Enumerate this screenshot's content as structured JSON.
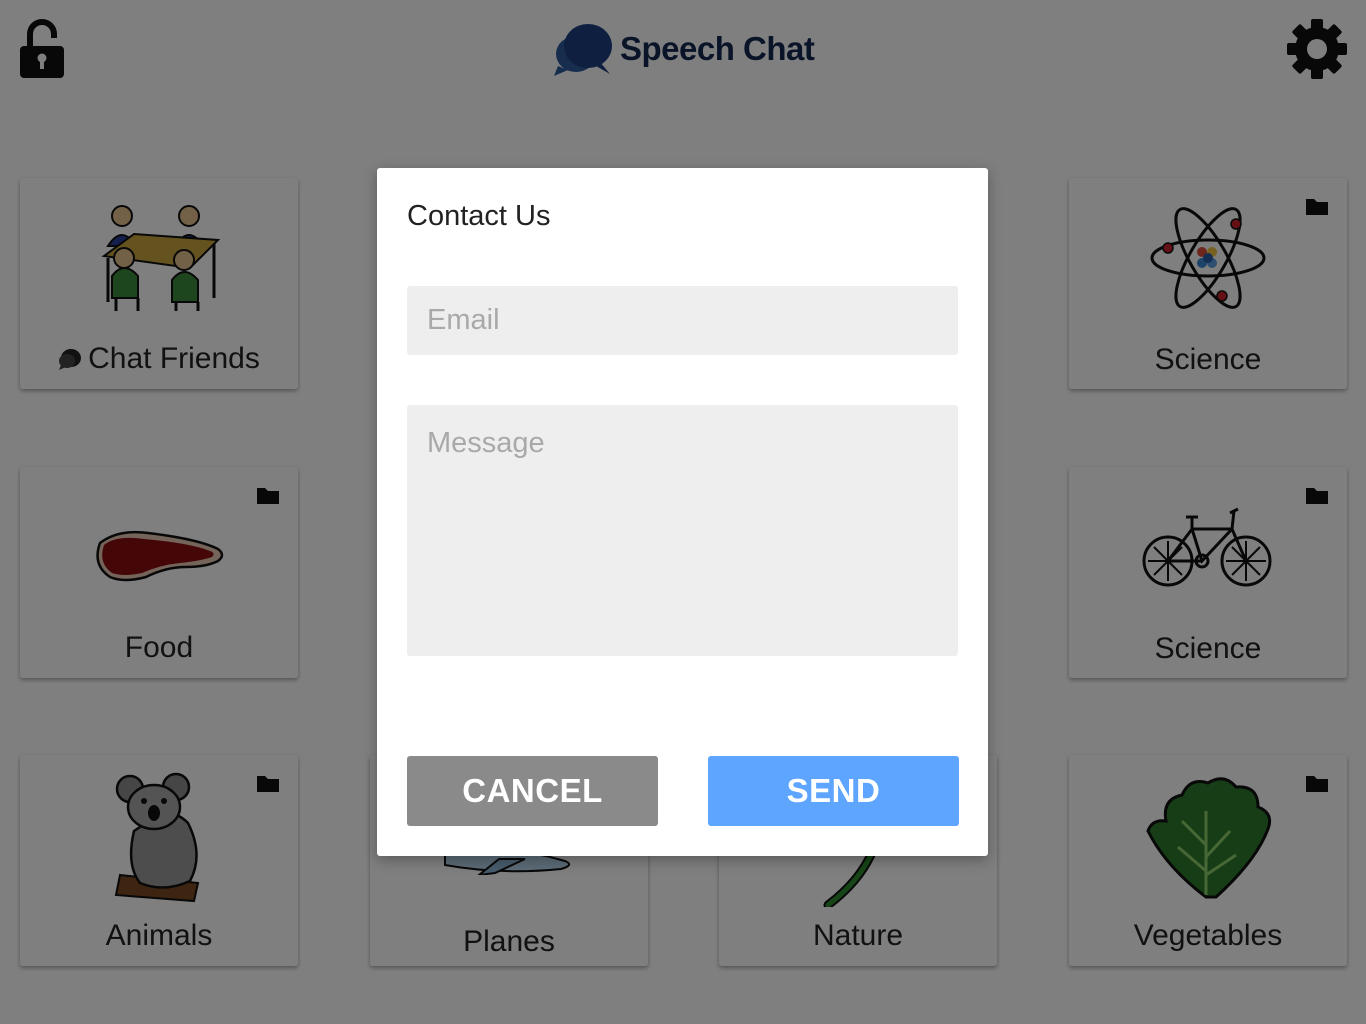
{
  "header": {
    "app_name": "Speech Chat",
    "lock_icon": "unlocked-padlock-icon",
    "settings_icon": "gear-icon",
    "brand_color": "#142850"
  },
  "tiles": [
    {
      "label": "Chat Friends",
      "icon": "people-at-table",
      "badge": "chat-bubble-icon"
    },
    {
      "label": "Science",
      "icon": "atom",
      "badge": "folder-icon"
    },
    {
      "label": "Food",
      "icon": "steak",
      "badge": "folder-icon"
    },
    {
      "label": "Science",
      "icon": "bicycle",
      "badge": "folder-icon"
    },
    {
      "label": "Animals",
      "icon": "koala",
      "badge": "folder-icon"
    },
    {
      "label": "Planes",
      "icon": "airplane"
    },
    {
      "label": "Nature",
      "icon": "plant-stem"
    },
    {
      "label": "Vegetables",
      "icon": "lettuce",
      "badge": "folder-icon"
    }
  ],
  "dialog": {
    "title": "Contact Us",
    "email_placeholder": "Email",
    "email_value": "",
    "message_placeholder": "Message",
    "message_value": "",
    "cancel_label": "CANCEL",
    "send_label": "SEND",
    "cancel_color": "#8a8a8a",
    "send_color": "#5ea5ff"
  }
}
